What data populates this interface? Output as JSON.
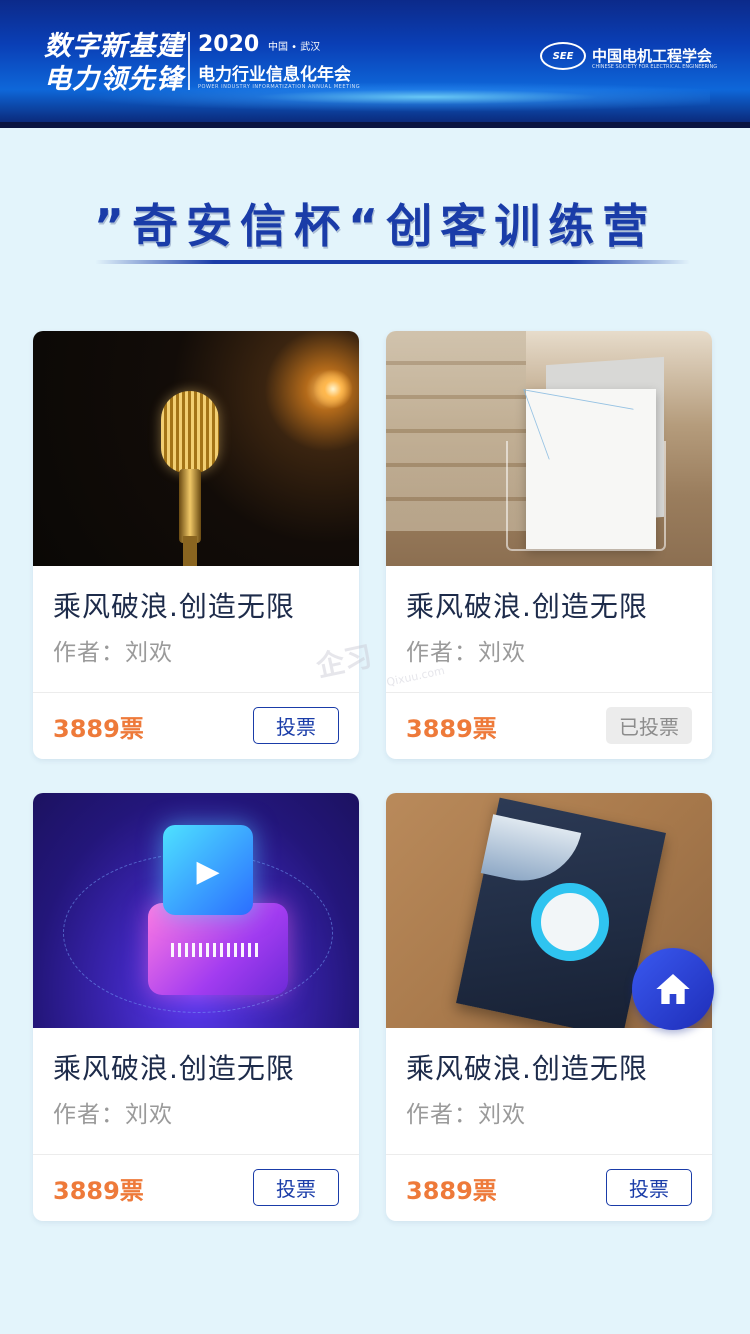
{
  "banner": {
    "slogan_line1": "数字新基建",
    "slogan_line2": "电力领先锋",
    "year": "2020",
    "location": "中国 • 武汉",
    "event_name": "电力行业信息化年会",
    "event_name_en": "POWER INDUSTRY INFORMATIZATION ANNUAL MEETING",
    "society_logo_text": "SEE",
    "society_name": "中国电机工程学会",
    "society_name_en": "CHINESE SOCIETY FOR ELECTRICAL ENGINEERING"
  },
  "page": {
    "title": "”奇安信杯“创客训练营"
  },
  "watermark": {
    "text": "企习",
    "sub": "Qixuu.com"
  },
  "cards": [
    {
      "title": "乘风破浪.创造无限",
      "author": "作者：刘欢",
      "votes": "3889票",
      "button": "投票",
      "voted": false,
      "image": "microphone"
    },
    {
      "title": "乘风破浪.创造无限",
      "author": "作者：刘欢",
      "votes": "3889票",
      "button": "已投票",
      "voted": true,
      "image": "brochure"
    },
    {
      "title": "乘风破浪.创造无限",
      "author": "作者：刘欢",
      "votes": "3889票",
      "button": "投票",
      "voted": false,
      "image": "video-cube"
    },
    {
      "title": "乘风破浪.创造无限",
      "author": "作者：刘欢",
      "votes": "3889票",
      "button": "投票",
      "voted": false,
      "image": "book"
    }
  ],
  "fab": {
    "icon": "home-icon"
  },
  "colors": {
    "primary": "#1a3ca8",
    "votes": "#ee7a3a",
    "background": "#e3f4fb"
  }
}
